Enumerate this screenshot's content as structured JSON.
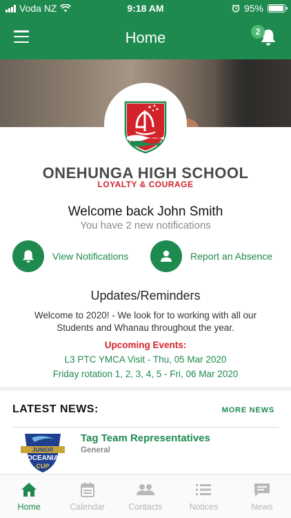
{
  "status_bar": {
    "carrier": "Voda NZ",
    "time": "9:18 AM",
    "battery": "95%",
    "battery_level": 0.95
  },
  "app_bar": {
    "title": "Home",
    "notification_count": "2"
  },
  "school": {
    "name": "ONEHUNGA HIGH SCHOOL",
    "motto": "LOYALTY & COURAGE"
  },
  "welcome": {
    "heading": "Welcome back John Smith",
    "notifications": "You have 2 new notifications"
  },
  "actions": {
    "view_notifications": "View Notifications",
    "report_absence": "Report an Absence"
  },
  "updates": {
    "title": "Updates/Reminders",
    "body": "Welcome to 2020! - We look for to working with all our Students and Whanau throughout the year.",
    "upcoming_title": "Upcoming Events:",
    "events": [
      "L3 PTC YMCA Visit - Thu, 05 Mar 2020",
      "Friday rotation 1, 2, 3, 4, 5 - Fri, 06 Mar 2020"
    ]
  },
  "news": {
    "header": "LATEST NEWS:",
    "more": "MORE NEWS",
    "items": [
      {
        "title": "Tag Team Representatives",
        "category": "General",
        "thumb": {
          "line1": "JUNIOR",
          "line2": "OCEANIA",
          "line3": "CUP"
        }
      }
    ]
  },
  "tabs": [
    {
      "label": "Home",
      "icon": "home-icon",
      "active": true
    },
    {
      "label": "Calendar",
      "icon": "calendar-icon",
      "active": false
    },
    {
      "label": "Contacts",
      "icon": "contacts-icon",
      "active": false
    },
    {
      "label": "Notices",
      "icon": "list-icon",
      "active": false
    },
    {
      "label": "News",
      "icon": "chat-icon",
      "active": false
    }
  ],
  "colors": {
    "brand_green": "#1e8a4f",
    "accent_red": "#d2232a",
    "badge_green": "#4fba73"
  }
}
